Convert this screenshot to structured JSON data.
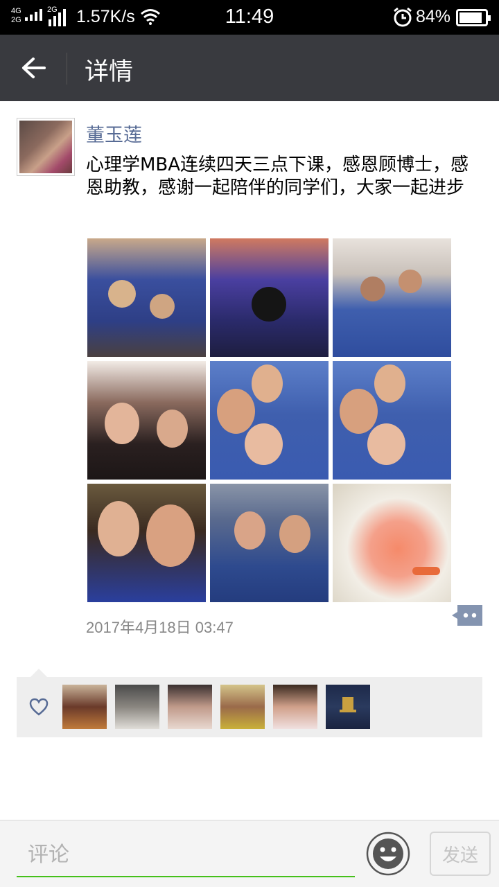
{
  "status_bar": {
    "network_top": "4G",
    "network_bottom": "2G",
    "network2": "2G",
    "speed": "1.57K/s",
    "time": "11:49",
    "battery": "84%"
  },
  "header": {
    "title": "详情"
  },
  "post": {
    "author": "董玉莲",
    "text": "心理学MBA连续四天三点下课，感恩顾博士，感恩助教，感谢一起陪伴的同学们，大家一起进步",
    "timestamp": "2017年4月18日 03:47",
    "photos": [
      {
        "icon": "group-photo"
      },
      {
        "icon": "crowd-photo"
      },
      {
        "icon": "group-photo"
      },
      {
        "icon": "selfie-photo"
      },
      {
        "icon": "selfie-photo"
      },
      {
        "icon": "selfie-photo"
      },
      {
        "icon": "selfie-photo"
      },
      {
        "icon": "selfie-photo"
      },
      {
        "icon": "food-photo"
      }
    ]
  },
  "likes": {
    "icon": "heart-icon",
    "count_avatars": 6
  },
  "comment_bar": {
    "placeholder": "评论",
    "send_label": "发送"
  },
  "colors": {
    "titlebar": "#393a3f",
    "link_blue": "#576b95",
    "accent_green": "#45c01a"
  }
}
